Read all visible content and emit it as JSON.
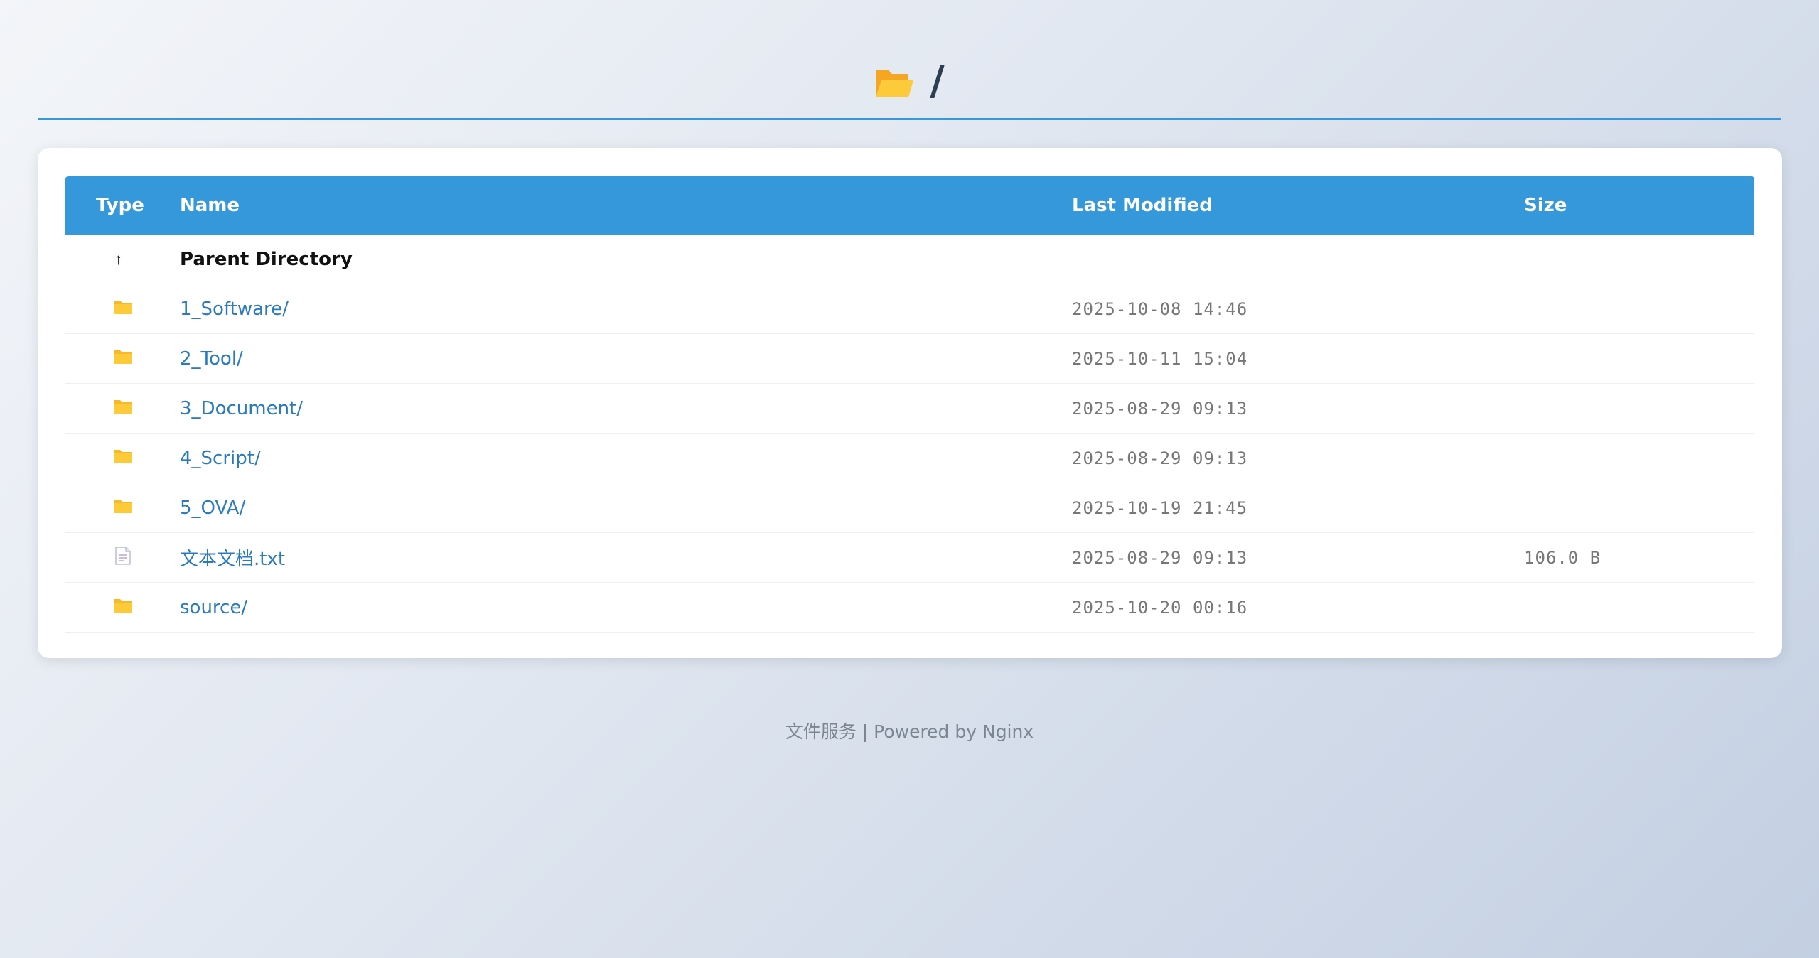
{
  "header": {
    "title": "/",
    "icon": "open-folder-icon"
  },
  "table": {
    "columns": [
      "Type",
      "Name",
      "Last Modified",
      "Size"
    ],
    "parent": {
      "icon": "up-arrow-icon",
      "label": "Parent Directory"
    },
    "rows": [
      {
        "icon": "folder-icon",
        "name": "1_Software/",
        "modified": "2025-10-08 14:46",
        "size": ""
      },
      {
        "icon": "folder-icon",
        "name": "2_Tool/",
        "modified": "2025-10-11 15:04",
        "size": ""
      },
      {
        "icon": "folder-icon",
        "name": "3_Document/",
        "modified": "2025-08-29 09:13",
        "size": ""
      },
      {
        "icon": "folder-icon",
        "name": "4_Script/",
        "modified": "2025-08-29 09:13",
        "size": ""
      },
      {
        "icon": "folder-icon",
        "name": "5_OVA/",
        "modified": "2025-10-19 21:45",
        "size": ""
      },
      {
        "icon": "file-icon",
        "name": "文本文档.txt",
        "modified": "2025-08-29 09:13",
        "size": "106.0 B"
      },
      {
        "icon": "folder-icon",
        "name": "source/",
        "modified": "2025-10-20 00:16",
        "size": ""
      }
    ]
  },
  "footer": {
    "text": "文件服务 | Powered by Nginx"
  },
  "colors": {
    "accent": "#3498db",
    "link": "#2a7ac0",
    "folder": "#fdcb3a"
  }
}
